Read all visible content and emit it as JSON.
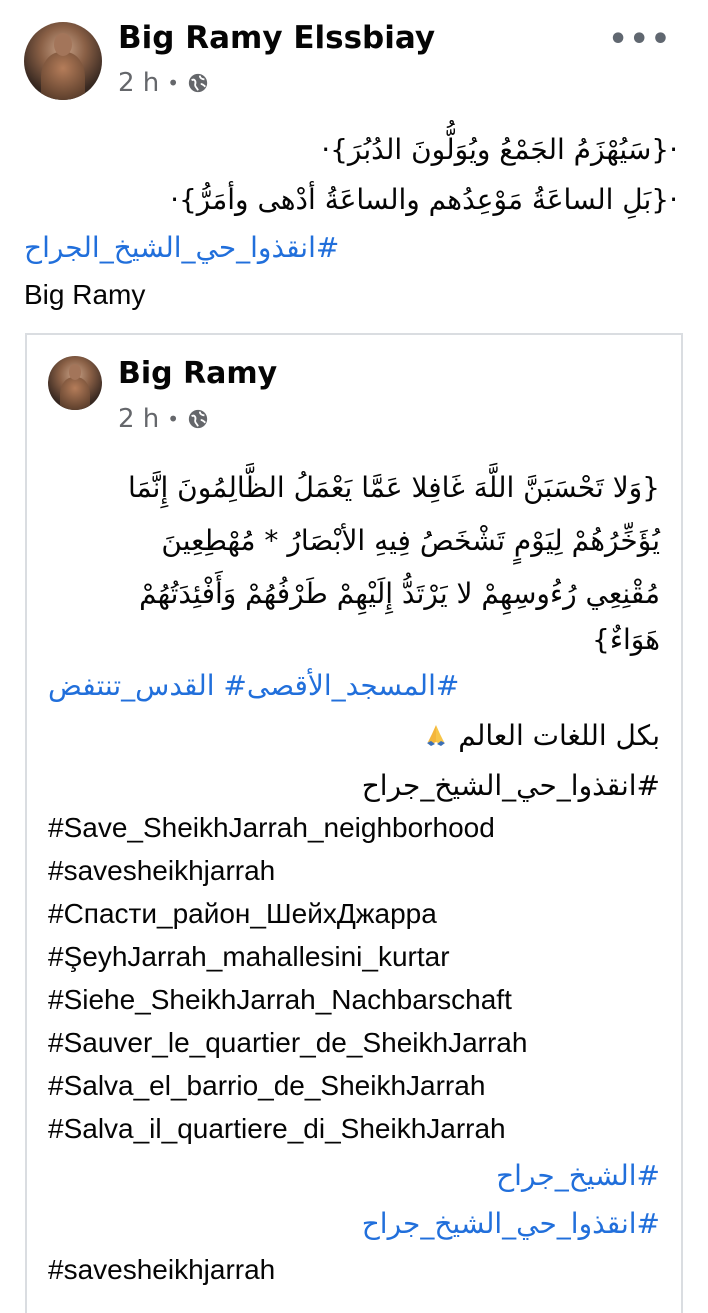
{
  "post": {
    "author": "Big Ramy Elssbiay",
    "time": "2 h",
    "separator": "•",
    "more_label": "•••",
    "lines": [
      "·{سَيُهْزَمُ الجَمْعُ ويُوَلُّونَ الدُبُرَ}·",
      "·{بَلِ الساعَةُ مَوْعِدُهم والساعَةُ أدْهى وأمَرُّ}·"
    ],
    "hashtag": "#انقذوا_حي_الشيخ_الجراح",
    "mention": "Big Ramy"
  },
  "shared": {
    "author": "Big Ramy",
    "time": "2 h",
    "separator": "•",
    "verse_lines": [
      "{وَلا تَحْسَبَنَّ اللَّهَ غَافِلا عَمَّا يَعْمَلُ الظَّالِمُونَ إِنَّمَا",
      "يُؤَخِّرُهُمْ لِيَوْمٍ تَشْخَصُ فِيهِ الأبْصَارُ * مُهْطِعِينَ",
      "مُقْنِعِي رُءُوسِهِمْ لا يَرْتَدُّ إِلَيْهِمْ طَرْفُهُمْ وَأَفْئِدَتُهُمْ",
      "هَوَاءٌ}"
    ],
    "hashtag_pair": "#المسجد_الأقصى# القدس_تنتفض",
    "languages_line": "بكل اللغات العالم",
    "languages_emoji": "folded-hands",
    "plain_tag_ar": "#انقذوا_حي_الشيخ_جراح",
    "tags": [
      {
        "text": "#Save_SheikhJarrah_neighborhood",
        "link": true
      },
      {
        "text": "#savesheikhjarrah",
        "link": false
      },
      {
        "text": "#Спасти_район_ШейхДжарра",
        "link": true
      },
      {
        "text": "#ŞeyhJarrah_mahallesini_kurtar",
        "link": true
      },
      {
        "text": "#Siehe_SheikhJarrah_Nachbarschaft",
        "link": true
      },
      {
        "text": "#Sauver_le_quartier_de_SheikhJarrah",
        "link": true
      },
      {
        "text": "#Salva_el_barrio_de_SheikhJarrah",
        "link": true
      },
      {
        "text": "#Salva_il_quartiere_di_SheikhJarrah",
        "link": true
      }
    ],
    "tags_ar": [
      "#الشيخ_جراح",
      "#انقذوا_حي_الشيخ_جراح"
    ],
    "last_tag": "#savesheikhjarrah"
  },
  "colors": {
    "link": "#216fdb",
    "text": "#050505",
    "meta": "#65676b",
    "border": "#dadde1"
  }
}
